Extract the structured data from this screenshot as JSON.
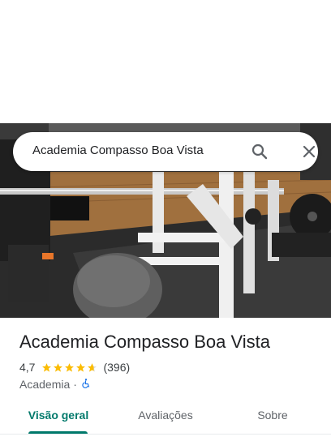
{
  "search": {
    "query": "Academia Compasso Boa Vista",
    "search_icon": "search-icon",
    "close_icon": "close-icon"
  },
  "place": {
    "name": "Academia Compasso Boa Vista",
    "rating": "4,7",
    "stars": 4.7,
    "review_count": "(396)",
    "category": "Academia",
    "separator": "·",
    "accessibility_icon": "wheelchair-icon"
  },
  "tabs": [
    {
      "label": "Visão geral",
      "active": true
    },
    {
      "label": "Avaliações",
      "active": false
    },
    {
      "label": "Sobre",
      "active": false
    }
  ],
  "colors": {
    "accent": "#00796b",
    "star": "#fbbc04",
    "accessibility": "#1a73e8"
  }
}
